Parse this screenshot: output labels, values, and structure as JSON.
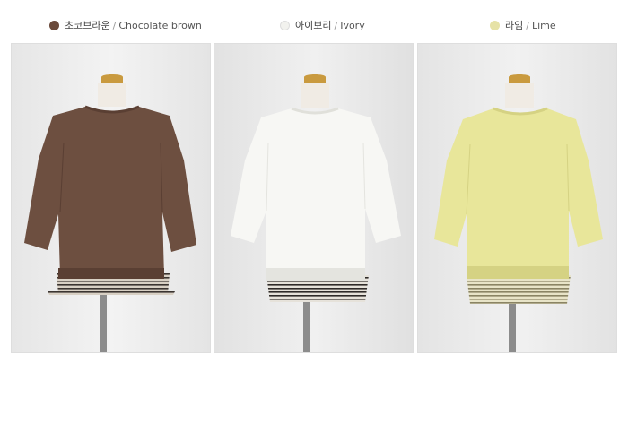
{
  "colors": [
    {
      "korean": "초코브라운",
      "english": "Chocolate brown",
      "dot_color": "#6b4a3b",
      "garment_color": "#6d4f40",
      "garment_shade": "#5a3f33"
    },
    {
      "korean": "아이보리",
      "english": "Ivory",
      "dot_color": "#f2f2ee",
      "garment_color": "#f7f7f4",
      "garment_shade": "#e4e4df"
    },
    {
      "korean": "라임",
      "english": "Lime",
      "dot_color": "#e6e2a6",
      "garment_color": "#e8e69a",
      "garment_shade": "#d5d283"
    }
  ],
  "separator": "/"
}
